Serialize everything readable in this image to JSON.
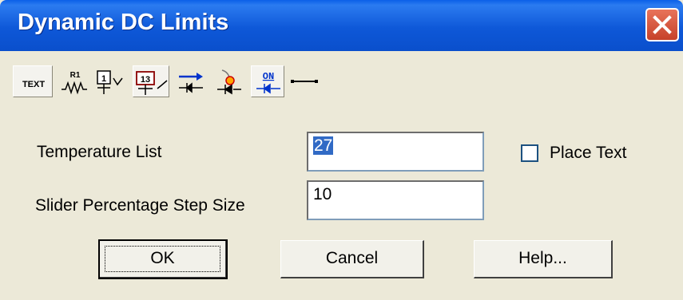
{
  "window": {
    "title": "Dynamic DC Limits"
  },
  "toolbar": {
    "text_label": "TEXT",
    "resistor_label": "R1",
    "node1_label": "1",
    "node13_label": "13",
    "on_label": "ON"
  },
  "form": {
    "temperature_label": "Temperature List",
    "temperature_value": "27",
    "step_label": "Slider Percentage Step Size",
    "step_value": "10",
    "place_text_label": "Place Text",
    "place_text_checked": false
  },
  "buttons": {
    "ok": "OK",
    "cancel": "Cancel",
    "help": "Help..."
  },
  "colors": {
    "title_bar": "#0A5FE8",
    "close_button": "#C6412A",
    "dialog_bg": "#ECE9D8",
    "selection": "#316AC5"
  }
}
